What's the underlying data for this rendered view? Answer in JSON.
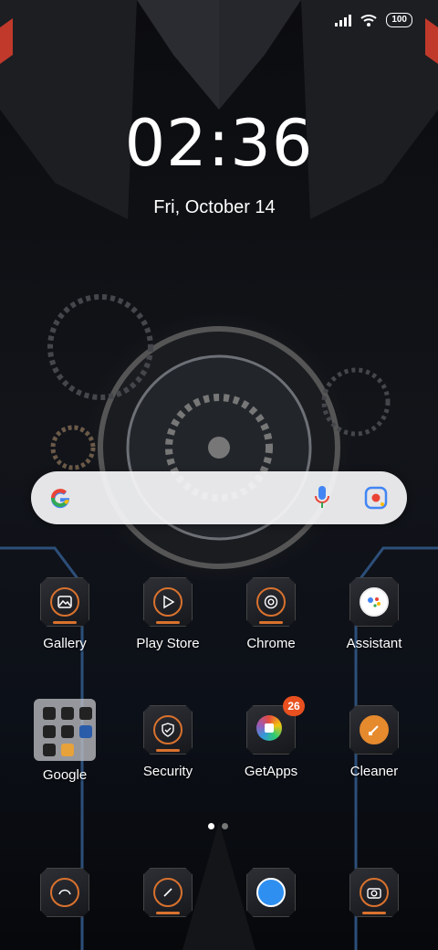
{
  "status_bar": {
    "battery": "100"
  },
  "lock": {
    "time": "02:36",
    "date": "Fri, October 14"
  },
  "search": {
    "logo": "google-g-icon",
    "mic": "microphone-icon",
    "lens": "google-lens-icon"
  },
  "apps_row1": [
    {
      "label": "Gallery",
      "icon": "image-icon"
    },
    {
      "label": "Play Store",
      "icon": "play-store-icon"
    },
    {
      "label": "Chrome",
      "icon": "chrome-icon"
    },
    {
      "label": "Assistant",
      "icon": "assistant-icon"
    }
  ],
  "apps_row2": [
    {
      "label": "Google",
      "icon": "folder-icon"
    },
    {
      "label": "Security",
      "icon": "shield-icon"
    },
    {
      "label": "GetApps",
      "icon": "getapps-icon",
      "badge": "26"
    },
    {
      "label": "Cleaner",
      "icon": "brush-icon"
    }
  ],
  "dock": [
    {
      "icon": "phone-icon"
    },
    {
      "icon": "compass-icon"
    },
    {
      "icon": "messages-icon"
    },
    {
      "icon": "camera-icon"
    }
  ],
  "pages": {
    "count": 2,
    "active": 1
  },
  "colors": {
    "accent": "#d9722e",
    "badge": "#e8501f"
  }
}
